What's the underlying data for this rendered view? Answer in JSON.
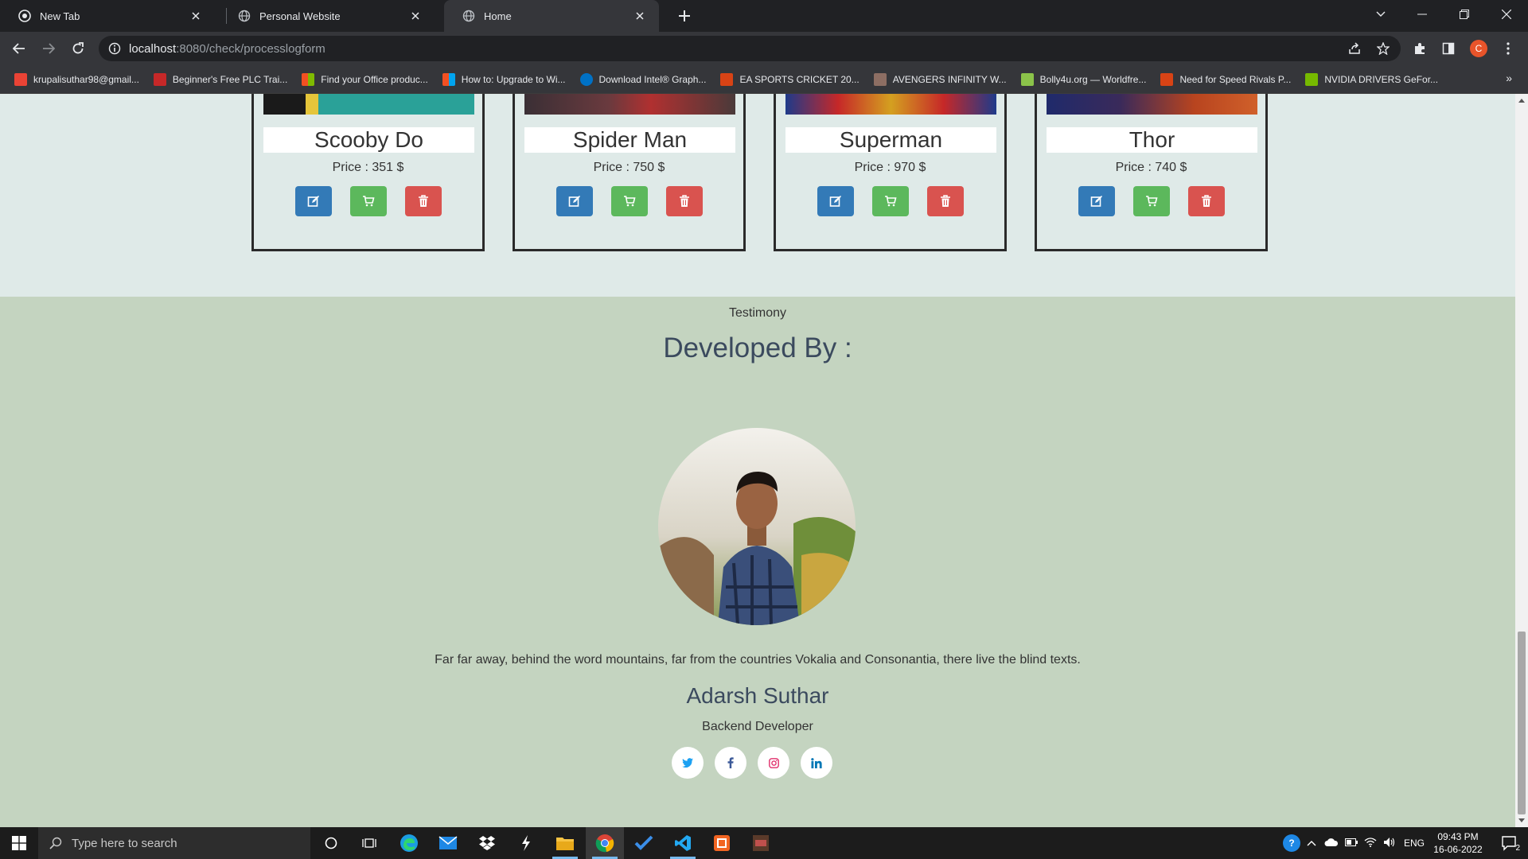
{
  "browser": {
    "tabs": [
      {
        "title": "New Tab",
        "icon": "chrome-icon"
      },
      {
        "title": "Personal Website",
        "icon": "globe-icon"
      },
      {
        "title": "Home",
        "icon": "globe-icon"
      }
    ],
    "url_host": "localhost",
    "url_path": ":8080/check/processlogform",
    "profile_initial": "C",
    "bookmarks": [
      {
        "label": "krupalisuthar98@gmail...",
        "color": "#ea4335"
      },
      {
        "label": "Beginner's Free PLC Trai...",
        "color": "#c62828"
      },
      {
        "label": "Find your Office produc...",
        "color": "#f25022"
      },
      {
        "label": "How to: Upgrade to Wi...",
        "color": "#f25022"
      },
      {
        "label": "Download Intel® Graph...",
        "color": "#0071c5"
      },
      {
        "label": "EA SPORTS CRICKET 20...",
        "color": "#d84315"
      },
      {
        "label": "AVENGERS INFINITY W...",
        "color": "#8d6e63"
      },
      {
        "label": "Bolly4u.org — Worldfre...",
        "color": "#8bc34a"
      },
      {
        "label": "Need for Speed Rivals P...",
        "color": "#d84315"
      },
      {
        "label": "NVIDIA DRIVERS GeFor...",
        "color": "#76b900"
      }
    ],
    "bookmarks_more": "»"
  },
  "products": [
    {
      "name": "Scooby Do",
      "price": "Price : 351 $",
      "colors": [
        "#1a1a1a",
        "#2aa198"
      ]
    },
    {
      "name": "Spider Man",
      "price": "Price : 750 $",
      "colors": [
        "#4a3a3a",
        "#b03030"
      ]
    },
    {
      "name": "Superman",
      "price": "Price : 970 $",
      "colors": [
        "#c62828",
        "#1e3a8a"
      ]
    },
    {
      "name": "Thor",
      "price": "Price : 740 $",
      "colors": [
        "#1f2a6b",
        "#b8441f"
      ]
    }
  ],
  "testimony": {
    "label": "Testimony",
    "heading": "Developed By :",
    "quote": "Far far away, behind the word mountains, far from the countries Vokalia and Consonantia, there live the blind texts.",
    "name": "Adarsh Suthar",
    "role": "Backend Developer",
    "socials": [
      {
        "name": "twitter",
        "glyph": "🐦",
        "color": "#1da1f2"
      },
      {
        "name": "facebook",
        "glyph": "f",
        "color": "#3b5998"
      },
      {
        "name": "instagram",
        "glyph": "◎",
        "color": "#e1306c"
      },
      {
        "name": "linkedin",
        "glyph": "in",
        "color": "#0077b5"
      }
    ]
  },
  "taskbar": {
    "search_placeholder": "Type here to search",
    "lang": "ENG",
    "time": "09:43 PM",
    "date": "16-06-2022",
    "notifications": "2"
  }
}
